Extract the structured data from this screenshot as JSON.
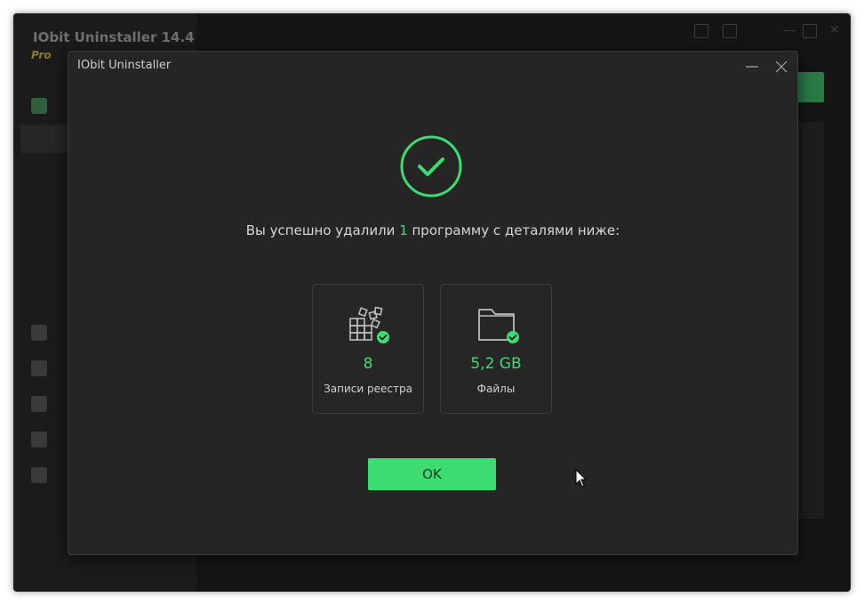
{
  "background_app": {
    "title": "IObit Uninstaller 14.4",
    "edition": "Pro"
  },
  "dialog": {
    "title": "IObit Uninstaller",
    "message_prefix": "Вы успешно удалили ",
    "message_count": "1",
    "message_suffix": " программу с деталями ниже:",
    "stats": [
      {
        "value": "8",
        "label": "Записи реестра",
        "icon": "registry-icon"
      },
      {
        "value": "5,2 GB",
        "label": "Файлы",
        "icon": "folder-icon"
      }
    ],
    "ok_label": "OK"
  },
  "colors": {
    "accent": "#3ddc73",
    "dialog_bg": "#252525",
    "window_bg": "#151515"
  }
}
